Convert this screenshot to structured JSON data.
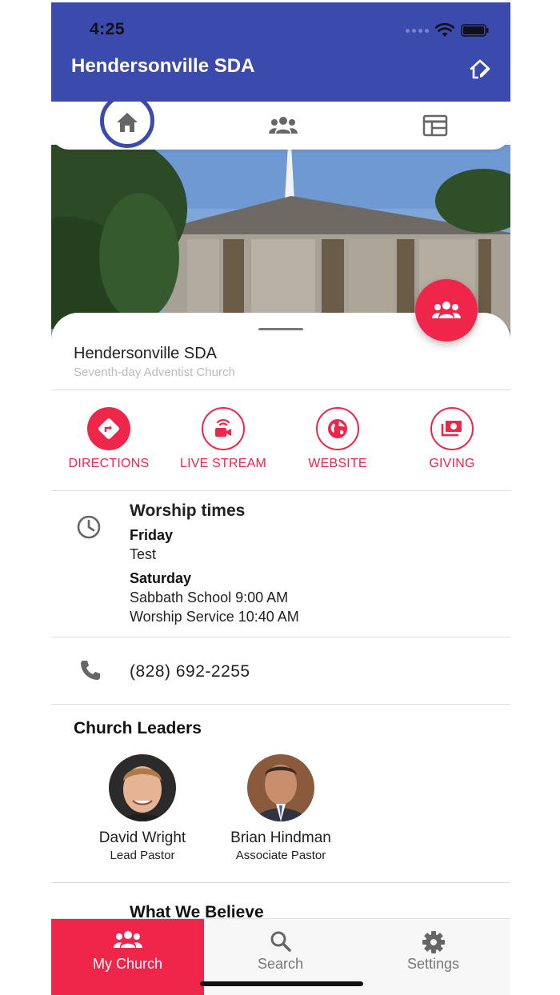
{
  "status_bar": {
    "time": "4:25"
  },
  "header": {
    "title": "Hendersonville SDA"
  },
  "top_tabs": [
    {
      "icon": "home-icon",
      "active": true
    },
    {
      "icon": "people-icon",
      "active": false
    },
    {
      "icon": "calendar-icon",
      "active": false
    }
  ],
  "church": {
    "name": "Hendersonville SDA",
    "subtitle": "Seventh-day Adventist Church"
  },
  "actions": [
    {
      "label": "DIRECTIONS",
      "icon": "directions-icon"
    },
    {
      "label": "LIVE STREAM",
      "icon": "live-stream-icon"
    },
    {
      "label": "WEBSITE",
      "icon": "globe-icon"
    },
    {
      "label": "GIVING",
      "icon": "money-icon"
    }
  ],
  "worship": {
    "title": "Worship times",
    "days": [
      {
        "day": "Friday",
        "lines": [
          "Test"
        ]
      },
      {
        "day": "Saturday",
        "lines": [
          "Sabbath School 9:00 AM",
          "Worship Service 10:40 AM"
        ]
      }
    ]
  },
  "phone": "(828) 692-2255",
  "leaders": {
    "title": "Church Leaders",
    "items": [
      {
        "name": "David Wright",
        "role": "Lead Pastor"
      },
      {
        "name": "Brian Hindman",
        "role": "Associate Pastor"
      }
    ]
  },
  "believe": {
    "title": "What We Believe"
  },
  "bottom_nav": [
    {
      "label": "My Church",
      "icon": "people-icon",
      "active": true
    },
    {
      "label": "Search",
      "icon": "search-icon",
      "active": false
    },
    {
      "label": "Settings",
      "icon": "gear-icon",
      "active": false
    }
  ],
  "colors": {
    "primary": "#3B4BAD",
    "accent": "#F0254A"
  }
}
